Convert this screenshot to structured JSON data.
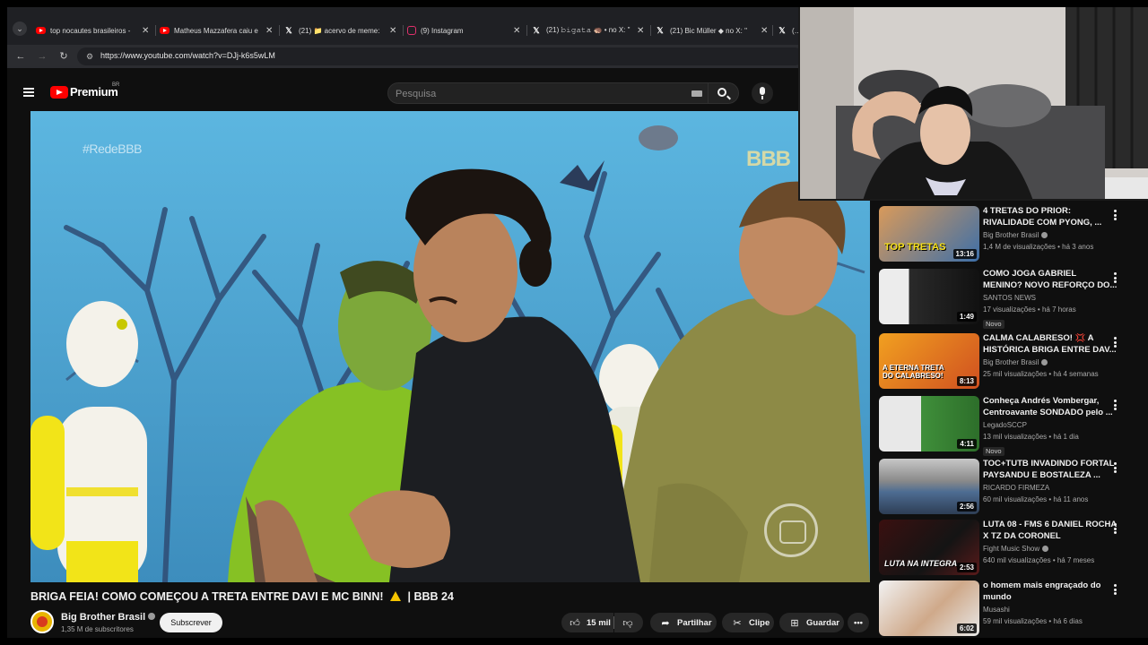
{
  "browser": {
    "tabs": [
      {
        "title": "top nocautes brasileiros -",
        "icon": "youtube"
      },
      {
        "title": "Matheus Mazzafera caiu e",
        "icon": "youtube"
      },
      {
        "title": "(21) 📁 acervo de meme:",
        "icon": "x"
      },
      {
        "title": "(9) Instagram",
        "icon": "instagram"
      },
      {
        "title": "(21) 𝚋𝚒𝚐𝚊𝚝𝚊 🦔 • no X: \"",
        "icon": "x"
      },
      {
        "title": "(21) Bic Müller ◆ no X: \"",
        "icon": "x"
      },
      {
        "title": "(2",
        "icon": "x"
      }
    ],
    "url": "https://www.youtube.com/watch?v=DJj-k6s5wLM"
  },
  "youtube": {
    "brand": "Premium",
    "region": "BR",
    "search_placeholder": "Pesquisa"
  },
  "video": {
    "watermark_tag": "#RedeBBB",
    "logo_text": "BBB",
    "title": "BRIGA FEIA! COMO COMEÇOU A TRETA ENTRE DAVI E MC BINN!",
    "title_tail": "| BBB 24",
    "channel": "Big Brother Brasil",
    "subscribers": "1,35 M de subscritores",
    "subscribe_label": "Subscrever",
    "likes": "15 mil",
    "share_label": "Partilhar",
    "clip_label": "Clipe",
    "save_label": "Guardar"
  },
  "sidebar": {
    "items": [
      {
        "title": "4 TRETAS DO PRIOR: RIVALIDADE COM PYONG, ...",
        "channel": "Big Brother Brasil",
        "verified": true,
        "meta": "1,4 M de visualizações • há 3 anos",
        "duration": "13:16",
        "badge": "",
        "thumb_text": "TOP TRETAS"
      },
      {
        "title": "COMO JOGA GABRIEL MENINO? NOVO REFORÇO DO...",
        "channel": "SANTOS NEWS",
        "verified": false,
        "meta": "17 visualizações • há 7 horas",
        "duration": "1:49",
        "badge": "Novo",
        "thumb_text": ""
      },
      {
        "title": "CALMA CALABRESO! 💢 A HISTÓRICA BRIGA ENTRE DAV...",
        "channel": "Big Brother Brasil",
        "verified": true,
        "meta": "25 mil visualizações • há 4 semanas",
        "duration": "8:13",
        "badge": "",
        "thumb_text": "A ETERNA TRETA DO CALABRESO!"
      },
      {
        "title": "Conheça Andrés Vombergar, Centroavante SONDADO pelo ...",
        "channel": "LegadoSCCP",
        "verified": false,
        "meta": "13 mil visualizações • há 1 dia",
        "duration": "4:11",
        "badge": "Novo",
        "thumb_text": ""
      },
      {
        "title": "TOC+TUTB INVADINDO FORTAL PAYSANDU E BOSTALEZA ...",
        "channel": "RICARDO FIRMEZA",
        "verified": false,
        "meta": "60 mil visualizações • há 11 anos",
        "duration": "2:56",
        "badge": "",
        "thumb_text": ""
      },
      {
        "title": "LUTA 08 - FMS 6 DANIEL ROCHA X TZ DA CORONEL",
        "channel": "Fight Music Show",
        "verified": true,
        "meta": "640 mil visualizações • há 7 meses",
        "duration": "2:53",
        "badge": "",
        "thumb_text": "LUTA NA INTEGRA"
      },
      {
        "title": "o homem mais engraçado do mundo",
        "channel": "Musashi",
        "verified": false,
        "meta": "59 mil visualizações • há 6 dias",
        "duration": "6:02",
        "badge": "",
        "thumb_text": ""
      }
    ]
  },
  "colors": {
    "yt_red": "#ff0000",
    "background": "#0f0f0f",
    "chip": "#272727"
  }
}
